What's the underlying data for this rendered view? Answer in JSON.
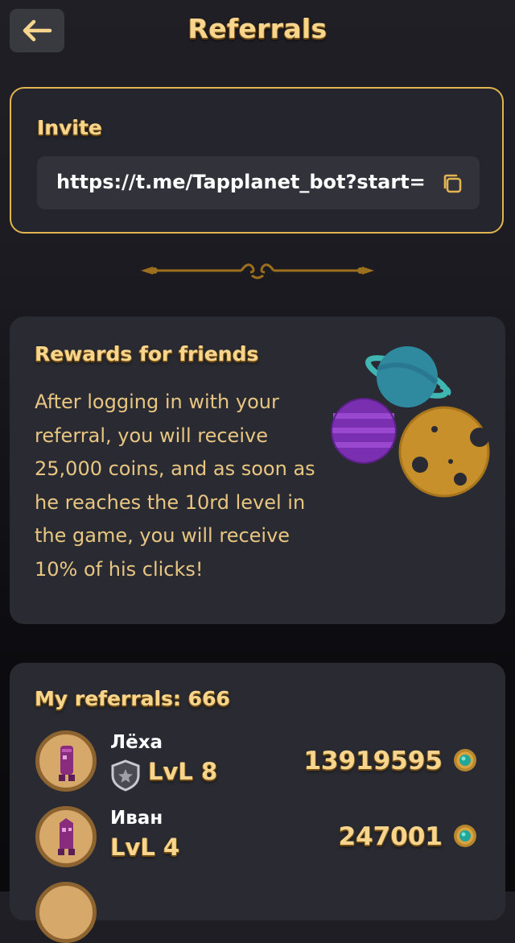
{
  "header": {
    "title": "Referrals",
    "back_icon": "arrow-left-icon"
  },
  "invite": {
    "label": "Invite",
    "link": "https://t.me/Tapplanet_bot?start=",
    "copy_icon": "copy-icon"
  },
  "rewards": {
    "title": "Rewards for friends",
    "text": "After logging in with your referral, you will receive 25,000 coins, and as soon as he reaches the 10rd level in the game, you will receive 10% of his clicks!"
  },
  "referrals": {
    "title": "My referrals: 666",
    "items": [
      {
        "name": "Лёха",
        "level": "LvL 8",
        "score": "13919595",
        "has_badge": true
      },
      {
        "name": "Иван",
        "level": "LvL 4",
        "score": "247001",
        "has_badge": false
      }
    ]
  },
  "colors": {
    "gold": "#f7d58d",
    "border_gold": "#e2b550",
    "card": "#2a2b32"
  }
}
